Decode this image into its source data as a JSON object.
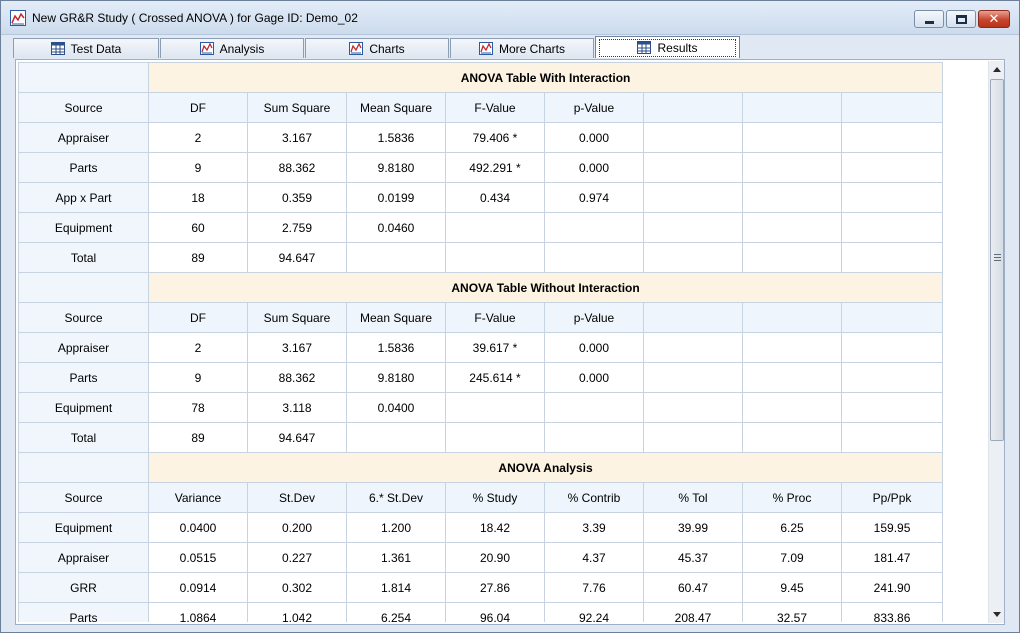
{
  "window": {
    "title": "New GR&R Study ( Crossed ANOVA ) for Gage ID: Demo_02",
    "close_glyph": "✕"
  },
  "tabs": [
    {
      "label": "Test Data",
      "icon": "table-icon"
    },
    {
      "label": "Analysis",
      "icon": "chart-icon"
    },
    {
      "label": "Charts",
      "icon": "chart-icon"
    },
    {
      "label": "More Charts",
      "icon": "chart-icon"
    },
    {
      "label": "Results",
      "icon": "table-icon",
      "active": true
    }
  ],
  "sections": [
    {
      "title": "ANOVA Table With Interaction",
      "columns": [
        "Source",
        "DF",
        "Sum Square",
        "Mean Square",
        "F-Value",
        "p-Value",
        "",
        "",
        ""
      ],
      "rows": [
        [
          "Appraiser",
          "2",
          "3.167",
          "1.5836",
          "79.406 *",
          "0.000",
          "",
          "",
          ""
        ],
        [
          "Parts",
          "9",
          "88.362",
          "9.8180",
          "492.291 *",
          "0.000",
          "",
          "",
          ""
        ],
        [
          "App x Part",
          "18",
          "0.359",
          "0.0199",
          "0.434",
          "0.974",
          "",
          "",
          ""
        ],
        [
          "Equipment",
          "60",
          "2.759",
          "0.0460",
          "",
          "",
          "",
          "",
          ""
        ],
        [
          "Total",
          "89",
          "94.647",
          "",
          "",
          "",
          "",
          "",
          ""
        ]
      ]
    },
    {
      "title": "ANOVA Table Without Interaction",
      "columns": [
        "Source",
        "DF",
        "Sum Square",
        "Mean Square",
        "F-Value",
        "p-Value",
        "",
        "",
        ""
      ],
      "rows": [
        [
          "Appraiser",
          "2",
          "3.167",
          "1.5836",
          "39.617 *",
          "0.000",
          "",
          "",
          ""
        ],
        [
          "Parts",
          "9",
          "88.362",
          "9.8180",
          "245.614 *",
          "0.000",
          "",
          "",
          ""
        ],
        [
          "Equipment",
          "78",
          "3.118",
          "0.0400",
          "",
          "",
          "",
          "",
          ""
        ],
        [
          "Total",
          "89",
          "94.647",
          "",
          "",
          "",
          "",
          "",
          ""
        ]
      ]
    },
    {
      "title": "ANOVA Analysis",
      "columns": [
        "Source",
        "Variance",
        "St.Dev",
        "6.* St.Dev",
        "% Study",
        "% Contrib",
        "% Tol",
        "% Proc",
        "Pp/Ppk"
      ],
      "rows": [
        [
          "Equipment",
          "0.0400",
          "0.200",
          "1.200",
          "18.42",
          "3.39",
          "39.99",
          "6.25",
          "159.95"
        ],
        [
          "Appraiser",
          "0.0515",
          "0.227",
          "1.361",
          "20.90",
          "4.37",
          "45.37",
          "7.09",
          "181.47"
        ],
        [
          "GRR",
          "0.0914",
          "0.302",
          "1.814",
          "27.86",
          "7.76",
          "60.47",
          "9.45",
          "241.90"
        ],
        [
          "Parts",
          "1.0864",
          "1.042",
          "6.254",
          "96.04",
          "92.24",
          "208.47",
          "32.57",
          "833.86"
        ]
      ]
    }
  ],
  "colors": {
    "section_title_bg": "#fcf3e2",
    "header_bg": "#eef5fc",
    "grid_line": "#c8d3e2",
    "close_button": "#c8452e"
  }
}
